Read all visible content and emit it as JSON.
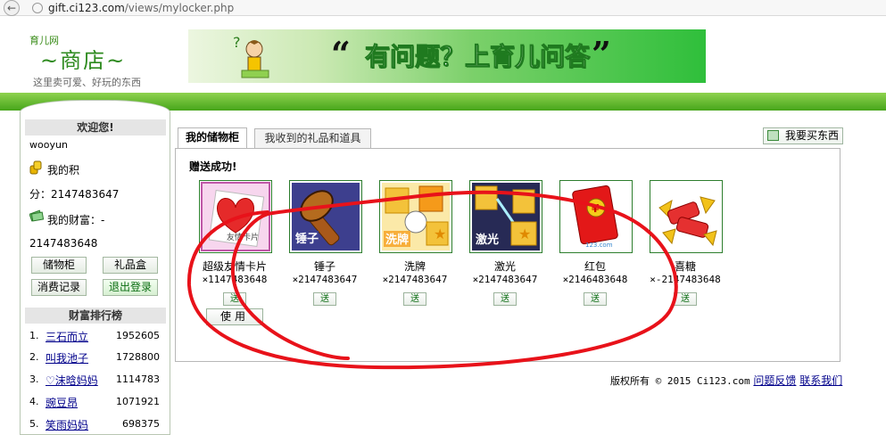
{
  "browser": {
    "url_host": "gift.ci123.com",
    "url_path": "/views/mylocker.php"
  },
  "logo": {
    "small": "育儿网",
    "main": "~商店~",
    "slogan": "这里卖可爱、好玩的东西"
  },
  "banner": {
    "open_quote": "“",
    "text": "有问题？上育儿问答",
    "close_quote": "”"
  },
  "sidebar": {
    "welcome_title": "欢迎您!",
    "username": "wooyun",
    "points_label": "我的积",
    "points_value": "分：2147483647",
    "wealth_label": "我的财富：-",
    "wealth_value": "2147483648",
    "buttons": [
      "储物柜",
      "礼品盒",
      "消费记录",
      "退出登录"
    ],
    "rank_title": "财富排行榜",
    "ranks": [
      {
        "num": "1.",
        "name": "三石而立",
        "value": "1952605"
      },
      {
        "num": "2.",
        "name": "叫我池子",
        "value": "1728800"
      },
      {
        "num": "3.",
        "name": "♡沫晗妈妈",
        "value": "1114783"
      },
      {
        "num": "4.",
        "name": "豌豆昂",
        "value": "1071921"
      },
      {
        "num": "5.",
        "name": "笑雨妈妈",
        "value": "698375"
      }
    ]
  },
  "tabs": [
    "我的储物柜",
    "我收到的礼品和道具"
  ],
  "buy_button": "我要买东西",
  "message": "赠送成功!",
  "items": [
    {
      "name": "超级友情卡片",
      "count": "×1147483648",
      "icon": "friendship-card-icon",
      "label": "友情卡片"
    },
    {
      "name": "锤子",
      "count": "×2147483647",
      "icon": "hammer-icon",
      "label": "锤子"
    },
    {
      "name": "洗牌",
      "count": "×2147483647",
      "icon": "shuffle-icon",
      "label": "洗牌"
    },
    {
      "name": "激光",
      "count": "×2147483647",
      "icon": "laser-icon",
      "label": "激光"
    },
    {
      "name": "红包",
      "count": "×2146483648",
      "icon": "red-envelope-icon",
      "label": "123.com"
    },
    {
      "name": "喜糖",
      "count": "×-2147483648",
      "icon": "wedding-candy-icon",
      "label": ""
    }
  ],
  "send_label": "送",
  "use_label": "使用",
  "footer": {
    "copyright": "版权所有 © 2015 Ci123.com",
    "feedback": "问题反馈",
    "contact": "联系我们"
  },
  "colors": {
    "accent_green": "#46a51a",
    "link_blue": "#00008b",
    "annotation_red": "#e8121a"
  }
}
